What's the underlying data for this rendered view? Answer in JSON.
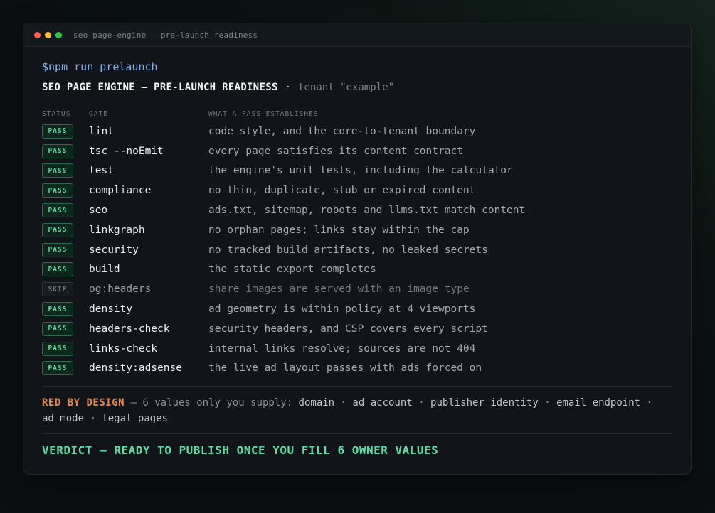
{
  "window": {
    "title": "seo-page-engine — pre-launch readiness"
  },
  "prompt": {
    "symbol": "$",
    "command": "npm run prelaunch"
  },
  "header": {
    "title": "SEO PAGE ENGINE — PRE-LAUNCH READINESS",
    "separator": "·",
    "tenant": "tenant \"example\""
  },
  "columns": {
    "status": "STATUS",
    "gate": "GATE",
    "what": "WHAT A PASS ESTABLISHES"
  },
  "gates": [
    {
      "status": "PASS",
      "gate": "lint",
      "desc": "code style, and the core-to-tenant boundary"
    },
    {
      "status": "PASS",
      "gate": "tsc --noEmit",
      "desc": "every page satisfies its content contract"
    },
    {
      "status": "PASS",
      "gate": "test",
      "desc": "the engine's unit tests, including the calculator"
    },
    {
      "status": "PASS",
      "gate": "compliance",
      "desc": "no thin, duplicate, stub or expired content"
    },
    {
      "status": "PASS",
      "gate": "seo",
      "desc": "ads.txt, sitemap, robots and llms.txt match content"
    },
    {
      "status": "PASS",
      "gate": "linkgraph",
      "desc": "no orphan pages; links stay within the cap"
    },
    {
      "status": "PASS",
      "gate": "security",
      "desc": "no tracked build artifacts, no leaked secrets"
    },
    {
      "status": "PASS",
      "gate": "build",
      "desc": "the static export completes"
    },
    {
      "status": "SKIP",
      "gate": "og:headers",
      "desc": "share images are served with an image type"
    },
    {
      "status": "PASS",
      "gate": "density",
      "desc": "ad geometry is within policy at 4 viewports"
    },
    {
      "status": "PASS",
      "gate": "headers-check",
      "desc": "security headers, and CSP covers every script"
    },
    {
      "status": "PASS",
      "gate": "links-check",
      "desc": "internal links resolve; sources are not 404"
    },
    {
      "status": "PASS",
      "gate": "density:adsense",
      "desc": "the live ad layout passes with ads forced on"
    }
  ],
  "red_by_design": {
    "label": "RED BY DESIGN",
    "intro": "— 6 values only you supply:",
    "values": [
      "domain",
      "ad account",
      "publisher identity",
      "email endpoint",
      "ad mode",
      "legal pages"
    ]
  },
  "verdict": "VERDICT — READY TO PUBLISH ONCE YOU FILL 6 OWNER VALUES",
  "colors": {
    "pass": "#65d4a0",
    "skip": "#6d757c",
    "red_by_design": "#e5894f",
    "verdict": "#5fdaa2",
    "prompt": "#7fb2f0"
  }
}
